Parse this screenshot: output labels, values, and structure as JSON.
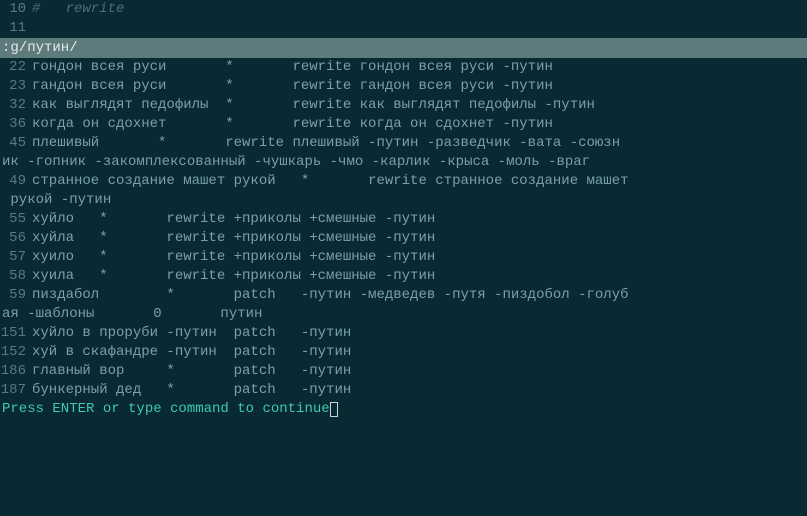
{
  "editor": {
    "top_lines": [
      {
        "no": "10",
        "text": "#   rewrite",
        "comment": true
      },
      {
        "no": "11",
        "text": "",
        "comment": false
      }
    ],
    "command_bar": ":g/путин/",
    "result_lines": [
      {
        "no": " 22",
        "text": "гондон всея руси       *       rewrite гондон всея руси -путин"
      },
      {
        "no": " 23",
        "text": "гандон всея руси       *       rewrite гандон всея руси -путин"
      },
      {
        "no": " 32",
        "text": "как выглядят педофилы  *       rewrite как выглядят педофилы -путин"
      },
      {
        "no": " 36",
        "text": "когда он сдохнет       *       rewrite когда он сдохнет -путин"
      },
      {
        "no": " 45",
        "text": "плешивый       *       rewrite плешивый -путин -разведчик -вата -союзн"
      },
      {
        "wrap": true,
        "text": "ик -гопник -закомплексованный -чушкарь -чмо -карлик -крыса -моль -враг"
      },
      {
        "no": " 49",
        "text": "странное создание машет рукой   *       rewrite странное создание машет"
      },
      {
        "wrap": true,
        "text": " рукой -путин"
      },
      {
        "no": " 55",
        "text": "хуйло   *       rewrite +приколы +смешные -путин"
      },
      {
        "no": " 56",
        "text": "хуйла   *       rewrite +приколы +смешные -путин"
      },
      {
        "no": " 57",
        "text": "хуило   *       rewrite +приколы +смешные -путин"
      },
      {
        "no": " 58",
        "text": "хуила   *       rewrite +приколы +смешные -путин"
      },
      {
        "no": " 59",
        "text": "пиздабол        *       patch   -путин -медведев -путя -пиздобол -голуб"
      },
      {
        "wrap": true,
        "text": "ая -шаблоны       0       путин"
      },
      {
        "no": "151",
        "text": "хуйло в проруби -путин  patch   -путин"
      },
      {
        "no": "152",
        "text": "хуй в скафандре -путин  patch   -путин"
      },
      {
        "no": "186",
        "text": "главный вор     *       patch   -путин"
      },
      {
        "no": "187",
        "text": "бункерный дед   *       patch   -путин"
      }
    ],
    "prompt": "Press ENTER or type command to continue"
  }
}
